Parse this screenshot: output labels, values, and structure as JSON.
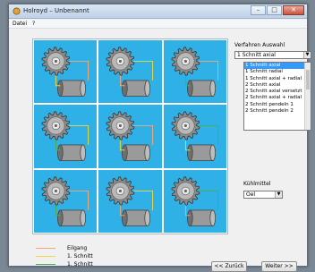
{
  "window": {
    "title": "Holroyd – Unbenannt"
  },
  "titlebar": {
    "minimize": "–",
    "maximize": "□",
    "close": "✕"
  },
  "menu": [
    "Datei",
    "?"
  ],
  "verfahren": {
    "label": "Verfahren Auswahl",
    "selected": "1 Schnitt axial",
    "options": [
      "1 Schnitt axial",
      "1 Schnitt radial",
      "1 Schnitt axial + radial",
      "2 Schnitt axial",
      "2 Schnitt axial versetzt",
      "2 Schnitt axial + radial",
      "2 Schnitt pendeln 1",
      "2 Schnitt pendeln 2"
    ],
    "selected_index": 0
  },
  "kuehlmittel": {
    "label": "Kühlmittel",
    "value": "Oel"
  },
  "legend": [
    {
      "label": "Eilgang",
      "color": "#f0a878"
    },
    {
      "label": "1. Schnitt",
      "color": "#e8d84a"
    },
    {
      "label": "1. Schnitt",
      "color": "#4caf50"
    }
  ],
  "buttons": {
    "back": "<< Zurück",
    "next": "Weiter >>"
  }
}
